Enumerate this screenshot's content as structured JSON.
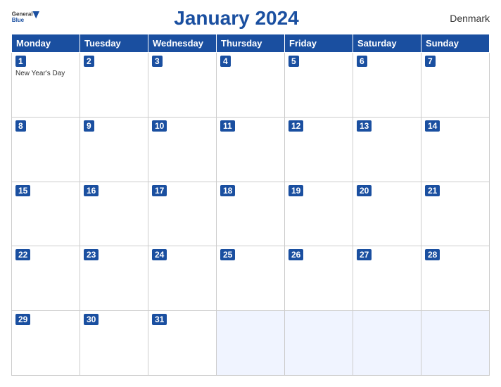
{
  "header": {
    "logo_general": "General",
    "logo_blue": "Blue",
    "month_title": "January 2024",
    "country": "Denmark"
  },
  "weekdays": [
    "Monday",
    "Tuesday",
    "Wednesday",
    "Thursday",
    "Friday",
    "Saturday",
    "Sunday"
  ],
  "weeks": [
    [
      {
        "day": 1,
        "holiday": "New Year's Day"
      },
      {
        "day": 2
      },
      {
        "day": 3
      },
      {
        "day": 4
      },
      {
        "day": 5
      },
      {
        "day": 6
      },
      {
        "day": 7
      }
    ],
    [
      {
        "day": 8
      },
      {
        "day": 9
      },
      {
        "day": 10
      },
      {
        "day": 11
      },
      {
        "day": 12
      },
      {
        "day": 13
      },
      {
        "day": 14
      }
    ],
    [
      {
        "day": 15
      },
      {
        "day": 16
      },
      {
        "day": 17
      },
      {
        "day": 18
      },
      {
        "day": 19
      },
      {
        "day": 20
      },
      {
        "day": 21
      }
    ],
    [
      {
        "day": 22
      },
      {
        "day": 23
      },
      {
        "day": 24
      },
      {
        "day": 25
      },
      {
        "day": 26
      },
      {
        "day": 27
      },
      {
        "day": 28
      }
    ],
    [
      {
        "day": 29
      },
      {
        "day": 30
      },
      {
        "day": 31
      },
      {
        "day": null
      },
      {
        "day": null
      },
      {
        "day": null
      },
      {
        "day": null
      }
    ]
  ]
}
